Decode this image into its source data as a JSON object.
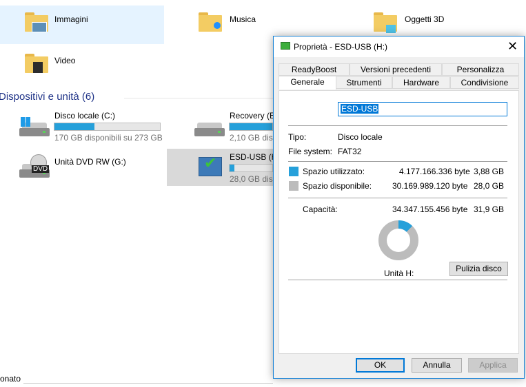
{
  "explorer": {
    "folders": [
      {
        "label": "Immagini"
      },
      {
        "label": "Musica"
      },
      {
        "label": "Oggetti 3D"
      },
      {
        "label": "Video"
      }
    ],
    "section_title": "Dispositivi e unità (6)",
    "drives": [
      {
        "name": "Disco locale (C:)",
        "free_text": "170 GB disponibili su 273 GB",
        "used_fraction": 0.38
      },
      {
        "name": "Recovery (E:",
        "free_text": "2,10 GB disp"
      },
      {
        "name": "Unità DVD RW (G:)"
      },
      {
        "name": "ESD-USB (H:",
        "free_text": "28,0 GB disp",
        "used_fraction": 0.12
      }
    ],
    "status_fragment": "onato"
  },
  "dialog": {
    "title": "Proprietà - ESD-USB (H:)",
    "tabs_row1": [
      "ReadyBoost",
      "Versioni precedenti",
      "Personalizza"
    ],
    "tabs_row2": [
      "Generale",
      "Strumenti",
      "Hardware",
      "Condivisione"
    ],
    "active_tab": "Generale",
    "volume_name": "ESD-USB",
    "type_label": "Tipo:",
    "type_value": "Disco locale",
    "fs_label": "File system:",
    "fs_value": "FAT32",
    "used_label": "Spazio utilizzato:",
    "used_bytes": "4.177.166.336 byte",
    "used_size": "3,88 GB",
    "free_label": "Spazio disponibile:",
    "free_bytes": "30.169.989.120 byte",
    "free_size": "28,0 GB",
    "capacity_label": "Capacità:",
    "capacity_bytes": "34.347.155.456 byte",
    "capacity_size": "31,9 GB",
    "drive_label": "Unità H:",
    "cleanup_button": "Pulizia disco",
    "ok_button": "OK",
    "cancel_button": "Annulla",
    "apply_button": "Applica",
    "used_fraction": 0.1216,
    "colors": {
      "used": "#26a0da",
      "free": "#bcbcbc"
    }
  }
}
